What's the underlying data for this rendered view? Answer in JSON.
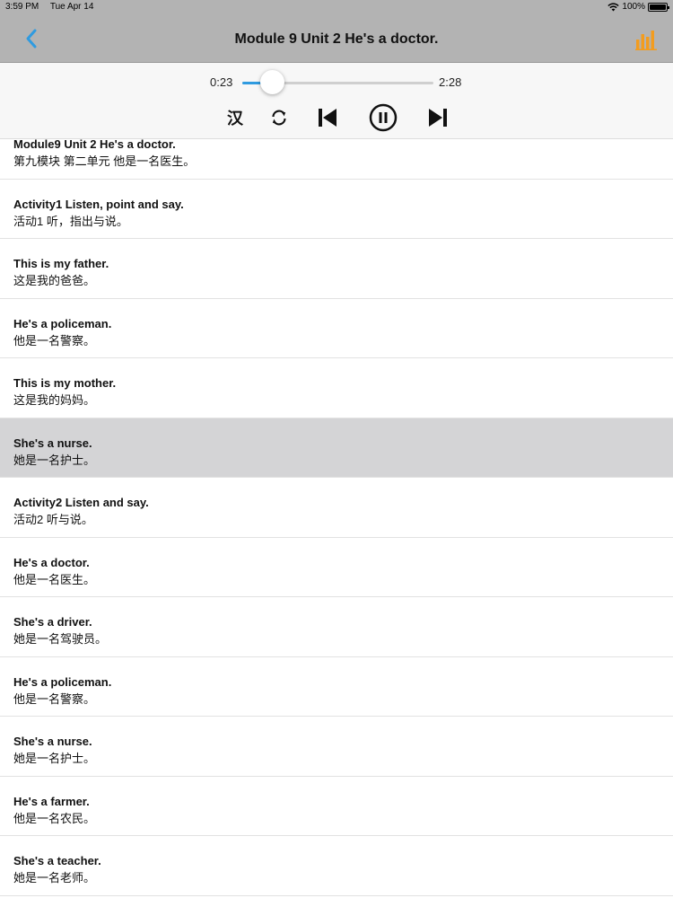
{
  "status": {
    "time": "3:59 PM",
    "date": "Tue Apr 14",
    "battery": "100%"
  },
  "nav": {
    "title": "Module 9  Unit 2 He's a doctor."
  },
  "player": {
    "current_time": "0:23",
    "total_time": "2:28",
    "progress": 0.155,
    "chinese_toggle": "汉"
  },
  "colors": {
    "accent": "#2f9be0",
    "chart_icon": "#f39c1e",
    "selected_row": "#d4d4d6"
  },
  "icons": {
    "back": "chevron-left-icon",
    "chart": "bar-chart-icon",
    "repeat": "repeat-icon",
    "previous": "skip-previous-icon",
    "pause": "pause-icon",
    "next": "skip-next-icon"
  },
  "sentences": [
    {
      "en": "Module9 Unit 2 He's a doctor.",
      "zh": "第九模块  第二单元  他是一名医生。"
    },
    {
      "en": "Activity1 Listen, point and say.",
      "zh": "活动1 听，指出与说。"
    },
    {
      "en": "This is my father.",
      "zh": "这是我的爸爸。"
    },
    {
      "en": "He's a policeman.",
      "zh": "他是一名警察。"
    },
    {
      "en": "This is my mother.",
      "zh": "这是我的妈妈。"
    },
    {
      "en": "She's a nurse.",
      "zh": "她是一名护士。"
    },
    {
      "en": "Activity2 Listen and say.",
      "zh": "活动2 听与说。"
    },
    {
      "en": "He's a doctor.",
      "zh": "他是一名医生。"
    },
    {
      "en": "She's a driver.",
      "zh": "她是一名驾驶员。"
    },
    {
      "en": "He's a policeman.",
      "zh": "他是一名警察。"
    },
    {
      "en": "She's a nurse.",
      "zh": "她是一名护士。"
    },
    {
      "en": "He's a farmer.",
      "zh": "他是一名农民。"
    },
    {
      "en": "She's a teacher.",
      "zh": "她是一名老师。"
    }
  ],
  "selected_index": 5
}
